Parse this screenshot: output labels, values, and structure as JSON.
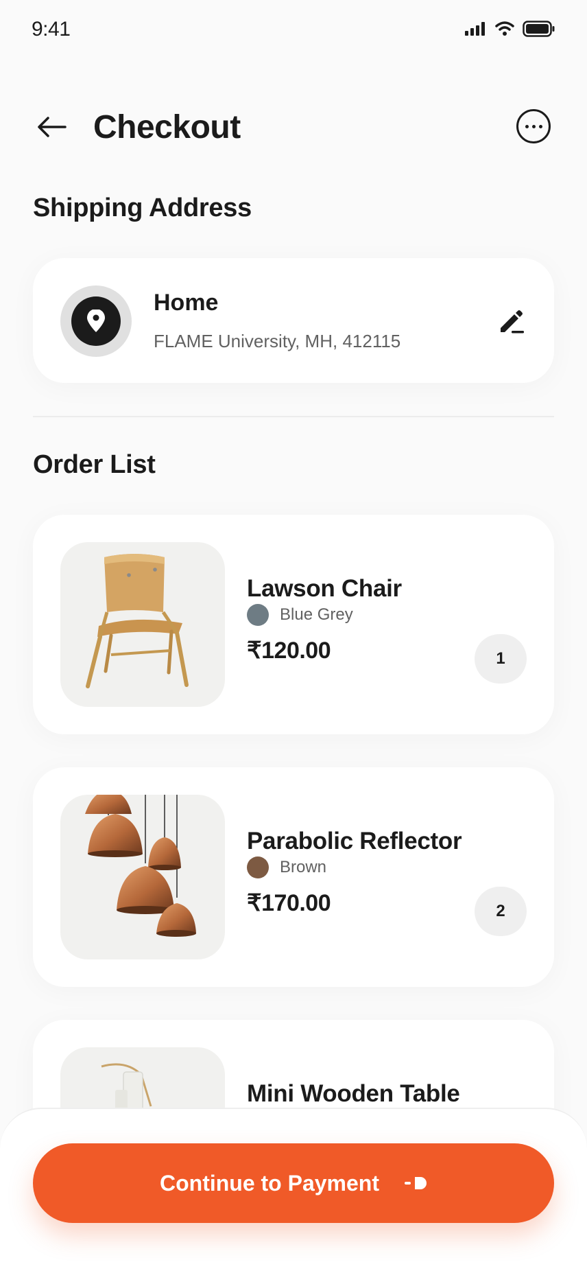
{
  "status_bar": {
    "time": "9:41"
  },
  "header": {
    "title": "Checkout",
    "back_icon": "arrow-left-icon",
    "more_icon": "more-horizontal-icon"
  },
  "shipping": {
    "section_title": "Shipping Address",
    "label": "Home",
    "address": "FLAME University, MH, 412115",
    "pin_icon": "location-pin-icon",
    "edit_icon": "edit-pencil-icon"
  },
  "order": {
    "section_title": "Order List",
    "items": [
      {
        "name": "Lawson Chair",
        "color_name": "Blue Grey",
        "color_hex": "#6e7c84",
        "price": "₹120.00",
        "quantity": "1",
        "image": "wooden-chair"
      },
      {
        "name": "Parabolic Reflector",
        "color_name": "Brown",
        "color_hex": "#7d5a42",
        "price": "₹170.00",
        "quantity": "2",
        "image": "copper-pendant-lamps"
      },
      {
        "name": "Mini Wooden Table",
        "image": "mini-wooden-table"
      }
    ]
  },
  "cta": {
    "label": "Continue to Payment",
    "icon": "arrow-right-icon"
  },
  "colors": {
    "accent": "#f05a28",
    "text": "#1b1b1b",
    "muted": "#616161",
    "background": "#fafafa"
  }
}
